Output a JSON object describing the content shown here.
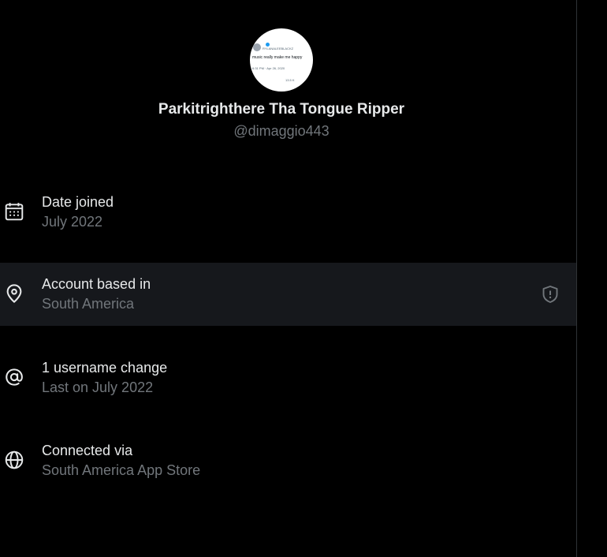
{
  "profile": {
    "display_name": "Parkitrighthere Tha Tongue Ripper",
    "handle": "@dimaggio443",
    "avatar": {
      "tweet_author": "RYLANALEEBLACKZ",
      "tweet_text": "music really make me happy",
      "tweet_time": "6:31 PM · Apr 26, 2020",
      "stat_left": "2k",
      "stat_right": "13.5 K"
    }
  },
  "rows": [
    {
      "icon": "calendar-icon",
      "title": "Date joined",
      "subtitle": "July 2022"
    },
    {
      "icon": "location-pin-icon",
      "title": "Account based in",
      "subtitle": "South America",
      "trailing_icon": "shield-icon"
    },
    {
      "icon": "at-sign-icon",
      "title": "1 username change",
      "subtitle": "Last on July 2022"
    },
    {
      "icon": "globe-icon",
      "title": "Connected via",
      "subtitle": "South America App Store"
    }
  ],
  "colors": {
    "background": "#000000",
    "highlight_row": "#16181c",
    "primary_text": "#e7e9ea",
    "secondary_text": "#71767b",
    "divider": "#2f3336"
  }
}
